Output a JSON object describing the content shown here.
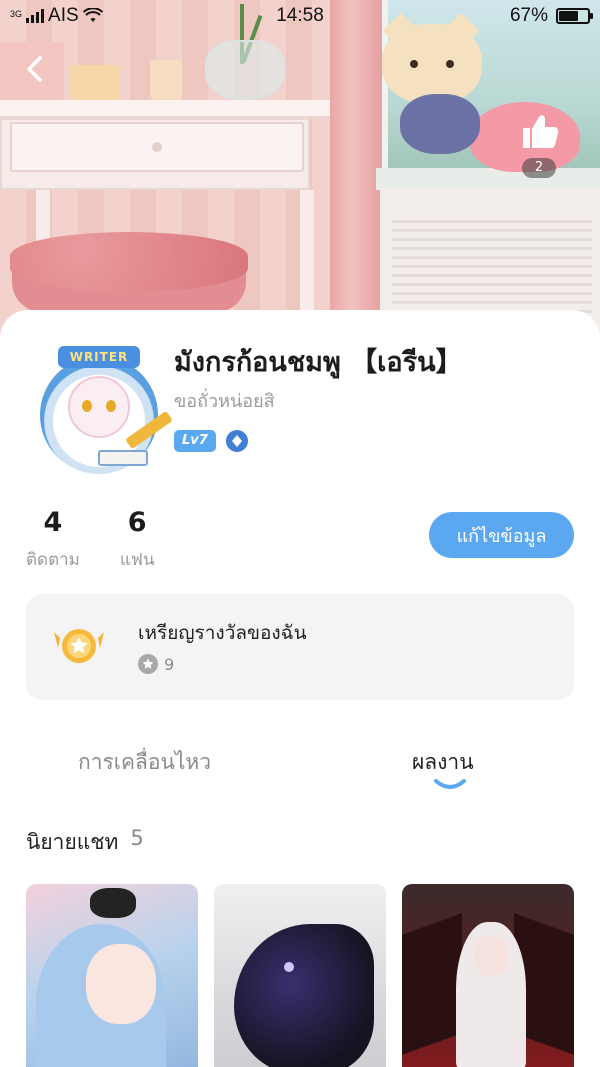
{
  "status_bar": {
    "network": "3G",
    "carrier": "AIS",
    "time": "14:58",
    "battery": "67%",
    "battery_level": 0.67
  },
  "header": {
    "like_count": "2"
  },
  "profile": {
    "name": "มังกรก้อนชมพู 【เอรีน】",
    "bio": "ขอถั่วหน่อยสิ",
    "level": "Lv7",
    "avatar_badge": "WRITER"
  },
  "stats": {
    "following_count": "4",
    "following_label": "ติดตาม",
    "fans_count": "6",
    "fans_label": "แฟน"
  },
  "edit_button_label": "แก้ไขข้อมูล",
  "medals": {
    "title": "เหรียญรางวัลของฉัน",
    "count": "9"
  },
  "tabs": [
    {
      "label": "การเคลื่อนไหว",
      "active": false
    },
    {
      "label": "ผลงาน",
      "active": true
    }
  ],
  "section": {
    "title": "นิยายแชท",
    "count": "5"
  },
  "colors": {
    "accent": "#5ba7f0",
    "card_bg": "#f4f4f4"
  }
}
